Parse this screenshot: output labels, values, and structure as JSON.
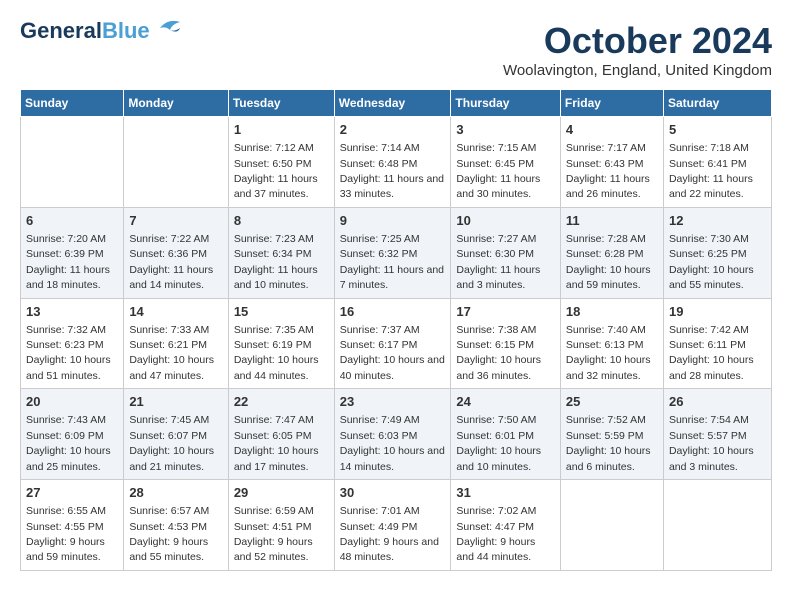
{
  "header": {
    "logo_general": "General",
    "logo_blue": "Blue",
    "month_title": "October 2024",
    "location": "Woolavington, England, United Kingdom"
  },
  "weekdays": [
    "Sunday",
    "Monday",
    "Tuesday",
    "Wednesday",
    "Thursday",
    "Friday",
    "Saturday"
  ],
  "weeks": [
    [
      {
        "day": "",
        "sunrise": "",
        "sunset": "",
        "daylight": ""
      },
      {
        "day": "",
        "sunrise": "",
        "sunset": "",
        "daylight": ""
      },
      {
        "day": "1",
        "sunrise": "Sunrise: 7:12 AM",
        "sunset": "Sunset: 6:50 PM",
        "daylight": "Daylight: 11 hours and 37 minutes."
      },
      {
        "day": "2",
        "sunrise": "Sunrise: 7:14 AM",
        "sunset": "Sunset: 6:48 PM",
        "daylight": "Daylight: 11 hours and 33 minutes."
      },
      {
        "day": "3",
        "sunrise": "Sunrise: 7:15 AM",
        "sunset": "Sunset: 6:45 PM",
        "daylight": "Daylight: 11 hours and 30 minutes."
      },
      {
        "day": "4",
        "sunrise": "Sunrise: 7:17 AM",
        "sunset": "Sunset: 6:43 PM",
        "daylight": "Daylight: 11 hours and 26 minutes."
      },
      {
        "day": "5",
        "sunrise": "Sunrise: 7:18 AM",
        "sunset": "Sunset: 6:41 PM",
        "daylight": "Daylight: 11 hours and 22 minutes."
      }
    ],
    [
      {
        "day": "6",
        "sunrise": "Sunrise: 7:20 AM",
        "sunset": "Sunset: 6:39 PM",
        "daylight": "Daylight: 11 hours and 18 minutes."
      },
      {
        "day": "7",
        "sunrise": "Sunrise: 7:22 AM",
        "sunset": "Sunset: 6:36 PM",
        "daylight": "Daylight: 11 hours and 14 minutes."
      },
      {
        "day": "8",
        "sunrise": "Sunrise: 7:23 AM",
        "sunset": "Sunset: 6:34 PM",
        "daylight": "Daylight: 11 hours and 10 minutes."
      },
      {
        "day": "9",
        "sunrise": "Sunrise: 7:25 AM",
        "sunset": "Sunset: 6:32 PM",
        "daylight": "Daylight: 11 hours and 7 minutes."
      },
      {
        "day": "10",
        "sunrise": "Sunrise: 7:27 AM",
        "sunset": "Sunset: 6:30 PM",
        "daylight": "Daylight: 11 hours and 3 minutes."
      },
      {
        "day": "11",
        "sunrise": "Sunrise: 7:28 AM",
        "sunset": "Sunset: 6:28 PM",
        "daylight": "Daylight: 10 hours and 59 minutes."
      },
      {
        "day": "12",
        "sunrise": "Sunrise: 7:30 AM",
        "sunset": "Sunset: 6:25 PM",
        "daylight": "Daylight: 10 hours and 55 minutes."
      }
    ],
    [
      {
        "day": "13",
        "sunrise": "Sunrise: 7:32 AM",
        "sunset": "Sunset: 6:23 PM",
        "daylight": "Daylight: 10 hours and 51 minutes."
      },
      {
        "day": "14",
        "sunrise": "Sunrise: 7:33 AM",
        "sunset": "Sunset: 6:21 PM",
        "daylight": "Daylight: 10 hours and 47 minutes."
      },
      {
        "day": "15",
        "sunrise": "Sunrise: 7:35 AM",
        "sunset": "Sunset: 6:19 PM",
        "daylight": "Daylight: 10 hours and 44 minutes."
      },
      {
        "day": "16",
        "sunrise": "Sunrise: 7:37 AM",
        "sunset": "Sunset: 6:17 PM",
        "daylight": "Daylight: 10 hours and 40 minutes."
      },
      {
        "day": "17",
        "sunrise": "Sunrise: 7:38 AM",
        "sunset": "Sunset: 6:15 PM",
        "daylight": "Daylight: 10 hours and 36 minutes."
      },
      {
        "day": "18",
        "sunrise": "Sunrise: 7:40 AM",
        "sunset": "Sunset: 6:13 PM",
        "daylight": "Daylight: 10 hours and 32 minutes."
      },
      {
        "day": "19",
        "sunrise": "Sunrise: 7:42 AM",
        "sunset": "Sunset: 6:11 PM",
        "daylight": "Daylight: 10 hours and 28 minutes."
      }
    ],
    [
      {
        "day": "20",
        "sunrise": "Sunrise: 7:43 AM",
        "sunset": "Sunset: 6:09 PM",
        "daylight": "Daylight: 10 hours and 25 minutes."
      },
      {
        "day": "21",
        "sunrise": "Sunrise: 7:45 AM",
        "sunset": "Sunset: 6:07 PM",
        "daylight": "Daylight: 10 hours and 21 minutes."
      },
      {
        "day": "22",
        "sunrise": "Sunrise: 7:47 AM",
        "sunset": "Sunset: 6:05 PM",
        "daylight": "Daylight: 10 hours and 17 minutes."
      },
      {
        "day": "23",
        "sunrise": "Sunrise: 7:49 AM",
        "sunset": "Sunset: 6:03 PM",
        "daylight": "Daylight: 10 hours and 14 minutes."
      },
      {
        "day": "24",
        "sunrise": "Sunrise: 7:50 AM",
        "sunset": "Sunset: 6:01 PM",
        "daylight": "Daylight: 10 hours and 10 minutes."
      },
      {
        "day": "25",
        "sunrise": "Sunrise: 7:52 AM",
        "sunset": "Sunset: 5:59 PM",
        "daylight": "Daylight: 10 hours and 6 minutes."
      },
      {
        "day": "26",
        "sunrise": "Sunrise: 7:54 AM",
        "sunset": "Sunset: 5:57 PM",
        "daylight": "Daylight: 10 hours and 3 minutes."
      }
    ],
    [
      {
        "day": "27",
        "sunrise": "Sunrise: 6:55 AM",
        "sunset": "Sunset: 4:55 PM",
        "daylight": "Daylight: 9 hours and 59 minutes."
      },
      {
        "day": "28",
        "sunrise": "Sunrise: 6:57 AM",
        "sunset": "Sunset: 4:53 PM",
        "daylight": "Daylight: 9 hours and 55 minutes."
      },
      {
        "day": "29",
        "sunrise": "Sunrise: 6:59 AM",
        "sunset": "Sunset: 4:51 PM",
        "daylight": "Daylight: 9 hours and 52 minutes."
      },
      {
        "day": "30",
        "sunrise": "Sunrise: 7:01 AM",
        "sunset": "Sunset: 4:49 PM",
        "daylight": "Daylight: 9 hours and 48 minutes."
      },
      {
        "day": "31",
        "sunrise": "Sunrise: 7:02 AM",
        "sunset": "Sunset: 4:47 PM",
        "daylight": "Daylight: 9 hours and 44 minutes."
      },
      {
        "day": "",
        "sunrise": "",
        "sunset": "",
        "daylight": ""
      },
      {
        "day": "",
        "sunrise": "",
        "sunset": "",
        "daylight": ""
      }
    ]
  ]
}
